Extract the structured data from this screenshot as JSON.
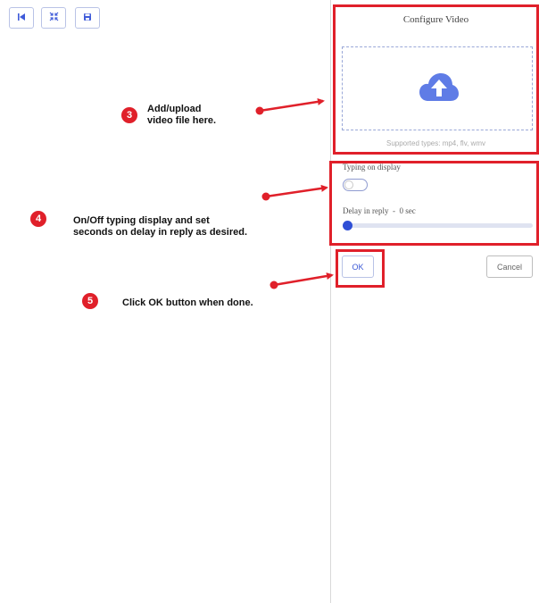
{
  "toolbar": {
    "buttons": [
      {
        "icon": "skip-back-icon"
      },
      {
        "icon": "collapse-icon"
      },
      {
        "icon": "save-icon"
      }
    ]
  },
  "configure_panel": {
    "title": "Configure Video",
    "upload": {
      "icon": "cloud-upload-icon",
      "supported_types": "Supported types: mp4, flv, wmv"
    },
    "typing_on_display": {
      "label": "Typing on display",
      "enabled": false
    },
    "delay": {
      "label": "Delay in reply  -  0 sec",
      "value_seconds": 0
    },
    "ok_label": "OK",
    "cancel_label": "Cancel"
  },
  "annotations": [
    {
      "number": "3",
      "line1": "Add/upload",
      "line2": "video file here."
    },
    {
      "number": "4",
      "line1": "On/Off typing display and set",
      "line2": "seconds on delay in reply as desired."
    },
    {
      "number": "5",
      "line1": "Click OK button when done.",
      "line2": ""
    }
  ],
  "colors": {
    "annotation_red": "#e0202a",
    "accent_blue": "#3f5bd9",
    "cloud_icon": "#5f7ce6"
  }
}
